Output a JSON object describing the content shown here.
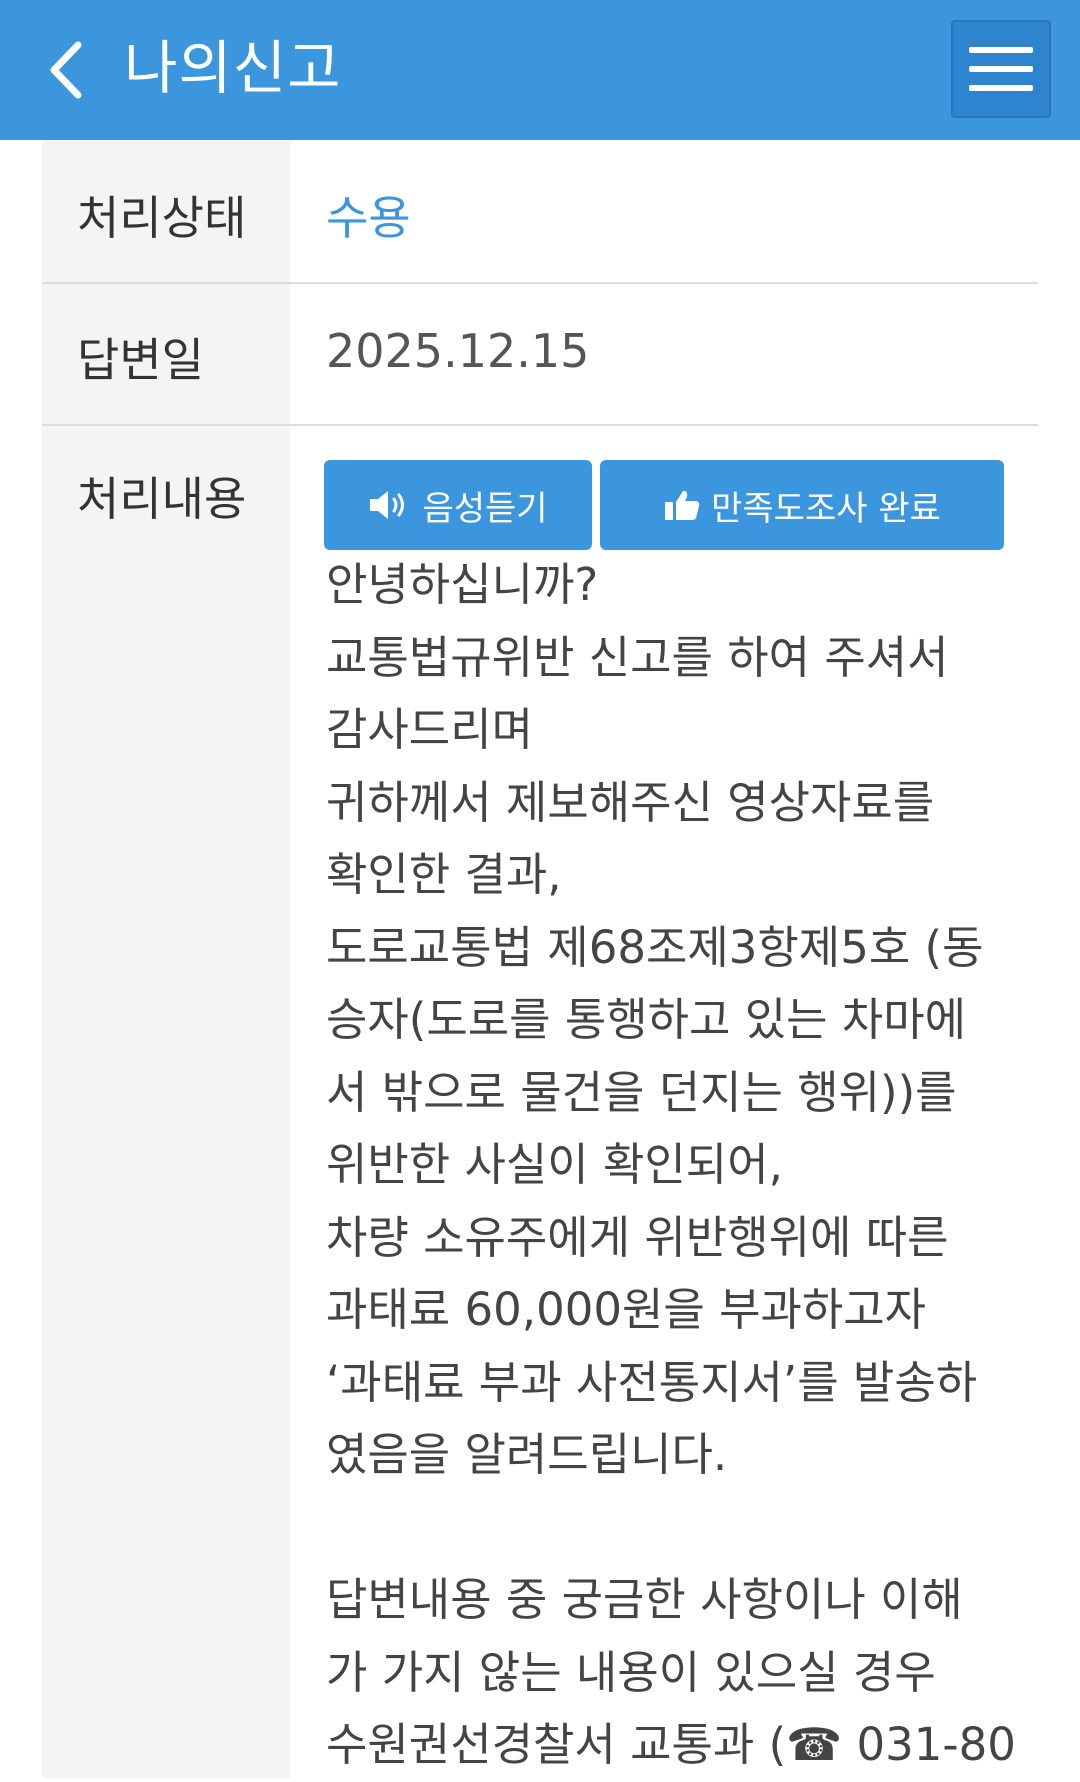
{
  "header": {
    "title": "나의신고",
    "back_icon": "chevron-left-icon",
    "menu_icon": "hamburger-menu-icon",
    "background": "#3c96dd"
  },
  "rows": {
    "status": {
      "label": "처리상태",
      "value": "수용",
      "value_color": "#3c96dd"
    },
    "answer_date": {
      "label": "답변일",
      "value": "2025.12.15"
    },
    "content": {
      "label": "처리내용",
      "buttons": {
        "voice": {
          "label": "음성듣기",
          "icon": "speaker-icon"
        },
        "survey": {
          "label": "만족도조사 완료",
          "icon": "thumbs-up-icon"
        }
      },
      "lines": [
        "안녕하십니까?",
        "교통법규위반 신고를 하여 주셔서",
        "감사드리며",
        "귀하께서 제보해주신 영상자료를",
        "확인한 결과,",
        "도로교통법 제68조제3항제5호 (동",
        "승자(도로를 통행하고 있는 차마에",
        "서 밖으로 물건을 던지는 행위))를",
        "위반한 사실이 확인되어,",
        "차량 소유주에게 위반행위에 따른",
        "과태료 60,000원을 부과하고자",
        "‘과태료 부과 사전통지서’를 발송하",
        "였음을 알려드립니다.",
        "",
        "답변내용 중 궁금한 사항이나 이해",
        "가 가지 않는 내용이 있으실 경우",
        "수원권선경찰서 교통과 (☎ 031-80"
      ]
    }
  }
}
